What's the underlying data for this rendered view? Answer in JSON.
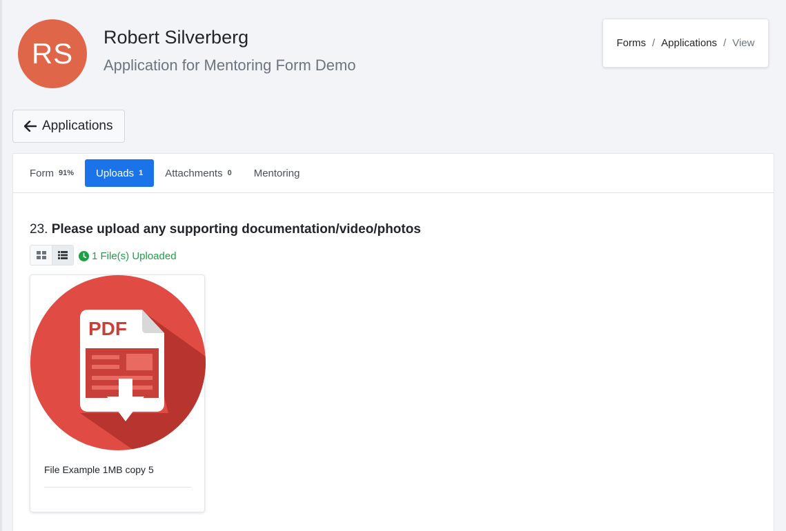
{
  "header": {
    "avatar_initials": "RS",
    "user_name": "Robert Silverberg",
    "subtitle": "Application for Mentoring Form Demo",
    "avatar_color": "#e0664a"
  },
  "breadcrumb": {
    "items": [
      "Forms",
      "Applications",
      "View"
    ],
    "separator": "/"
  },
  "back_button": {
    "label": "Applications"
  },
  "tabs": [
    {
      "label": "Form",
      "badge": "91%"
    },
    {
      "label": "Uploads",
      "badge": "1",
      "active": true
    },
    {
      "label": "Attachments",
      "badge": "0"
    },
    {
      "label": "Mentoring",
      "badge": ""
    }
  ],
  "question": {
    "number": "23.",
    "text": "Please upload any supporting documentation/video/photos"
  },
  "upload_status": "1 File(s) Uploaded",
  "files": [
    {
      "name": "File Example 1MB copy 5",
      "type_label": "PDF",
      "icon": "pdf-file-icon"
    }
  ],
  "colors": {
    "accent": "#1a73e8",
    "success": "#1e9e45",
    "pdf_red": "#e04b43"
  }
}
